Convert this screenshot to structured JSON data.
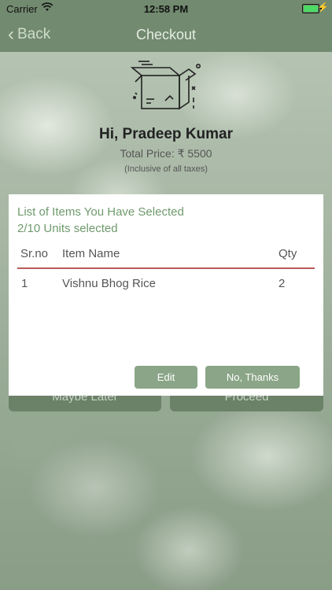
{
  "status_bar": {
    "carrier": "Carrier",
    "time": "12:58 PM"
  },
  "nav": {
    "back_label": "Back",
    "title": "Checkout"
  },
  "header": {
    "greeting": "Hi, Pradeep Kumar",
    "total_price": "Total Price: ₹ 5500",
    "taxes_note": "(Inclusive of all taxes)"
  },
  "under_buttons": {
    "maybe_later": "Maybe Later",
    "proceed": "Proceed"
  },
  "modal": {
    "title": "List of Items You Have Selected",
    "subtitle": "2/10 Units selected",
    "columns": {
      "srno": "Sr.no",
      "item_name": "Item Name",
      "qty": "Qty"
    },
    "rows": [
      {
        "srno": "1",
        "item_name": "Vishnu Bhog Rice",
        "qty": "2"
      }
    ],
    "edit_label": "Edit",
    "no_thanks_label": "No, Thanks"
  },
  "colors": {
    "accent_green": "#8aa587",
    "title_green": "#6f9a6d",
    "divider_red": "#b85a5a",
    "nav_bg": "#728a6f"
  }
}
